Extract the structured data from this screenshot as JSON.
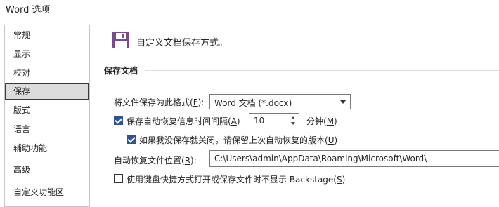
{
  "window": {
    "title": "Word 选项"
  },
  "sidebar": {
    "items": [
      {
        "label": "常规"
      },
      {
        "label": "显示"
      },
      {
        "label": "校对"
      },
      {
        "label": "保存",
        "selected": true
      },
      {
        "label": "版式"
      },
      {
        "label": "语言"
      },
      {
        "label": "辅助功能"
      },
      {
        "label": "高级"
      },
      {
        "label": "自定义功能区"
      }
    ]
  },
  "main": {
    "header_text": "自定义文档保存方式。",
    "section_title": "保存文档",
    "format": {
      "label_prefix": "将文件保存为此格式(",
      "label_key": "F",
      "label_suffix": "):",
      "value": "Word 文档 (*.docx)"
    },
    "autorecover": {
      "checked": true,
      "label_prefix": "保存自动恢复信息时间间隔(",
      "label_key": "A",
      "label_suffix": ")",
      "value": "10",
      "unit_prefix": "分钟(",
      "unit_key": "M",
      "unit_suffix": ")"
    },
    "keep_last": {
      "checked": true,
      "label_prefix": "如果我没保存就关闭，请保留上次自动恢复的版本(",
      "label_key": "U",
      "label_suffix": ")"
    },
    "autorecover_location": {
      "label_prefix": "自动恢复文件位置(",
      "label_key": "R",
      "label_suffix": "):",
      "value": "C:\\Users\\admin\\AppData\\Roaming\\Microsoft\\Word\\"
    },
    "no_backstage": {
      "checked": false,
      "label_prefix": "使用键盘快捷方式打开或保存文件时不显示 Backstage(",
      "label_key": "S",
      "label_suffix": ")"
    }
  },
  "colors": {
    "accent": "#2f5496",
    "save_icon": "#7a4b8c",
    "selected_bg": "#dcdcdc"
  },
  "icons": {
    "header": "save-disk-icon",
    "dropdown": "chevron-down-icon"
  }
}
